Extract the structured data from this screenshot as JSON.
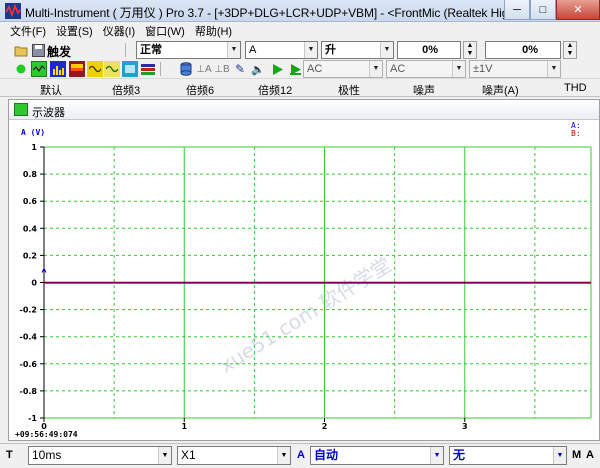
{
  "window": {
    "title": "Multi-Instrument ( 万用仪 ) Pro 3.7   -   [+3DP+DLG+LCR+UDP+VBM]   -   <FrontMic (Realtek High Definiti",
    "minimize": "─",
    "maximize": "□",
    "close": "✕"
  },
  "menu": [
    "文件(F)",
    "设置(S)",
    "仪器(I)",
    "窗口(W)",
    "帮助(H)"
  ],
  "toolbar1": {
    "trigger_label": "触发",
    "trigger_mode": "正常",
    "trigger_channel": "A",
    "trigger_edge": "升",
    "trigger_level": "0%",
    "trigger_pos": "0%"
  },
  "toolbar2": {
    "coupling_a": "AC",
    "coupling_b": "AC",
    "range": "±1V"
  },
  "presets": [
    "默认",
    "倍频3",
    "倍频6",
    "倍频12",
    "极性",
    "噪声",
    "噪声(A)",
    "THD"
  ],
  "oscilloscope": {
    "title": "示波器",
    "legend_a": "A: ",
    "legend_b": "B: ",
    "timestamp": "+09:56:49:074",
    "watermark": "xue51.com 软件学堂"
  },
  "chart_data": {
    "type": "line",
    "title": "",
    "xlabel": "",
    "ylabel": "A (V)",
    "xlim": [
      0,
      3.9
    ],
    "ylim": [
      -1,
      1
    ],
    "x_ticks": [
      0,
      1,
      2,
      3
    ],
    "y_ticks": [
      1,
      0.8,
      0.6,
      0.4,
      0.2,
      0,
      -0.2,
      -0.4,
      -0.6,
      -0.8,
      -1
    ],
    "y_tick_labels": [
      "1",
      "0.8",
      "0.6",
      "0.4",
      "0.2",
      "0",
      "-0.2",
      "-0.4",
      "-0.6",
      "-0.8",
      "-1"
    ],
    "grid": true,
    "series": [
      {
        "name": "A",
        "color": "#0000cc",
        "x": [
          0,
          3.9
        ],
        "y": [
          0,
          0
        ]
      },
      {
        "name": "B",
        "color": "#cc0000",
        "x": [
          0,
          3.9
        ],
        "y": [
          0,
          0
        ]
      }
    ]
  },
  "statusbar": {
    "t_label": "T",
    "timebase": "10ms",
    "zoom": "X1",
    "a_label": "A",
    "a_scale": "自动",
    "b_scale": "无",
    "m_label": "M",
    "a2_label": "A"
  },
  "colors": {
    "grid": "#33cc33",
    "axis": "#000000",
    "channel_a": "#0000cc",
    "channel_b": "#cc0000",
    "titlebar": "#c9d8ee"
  }
}
